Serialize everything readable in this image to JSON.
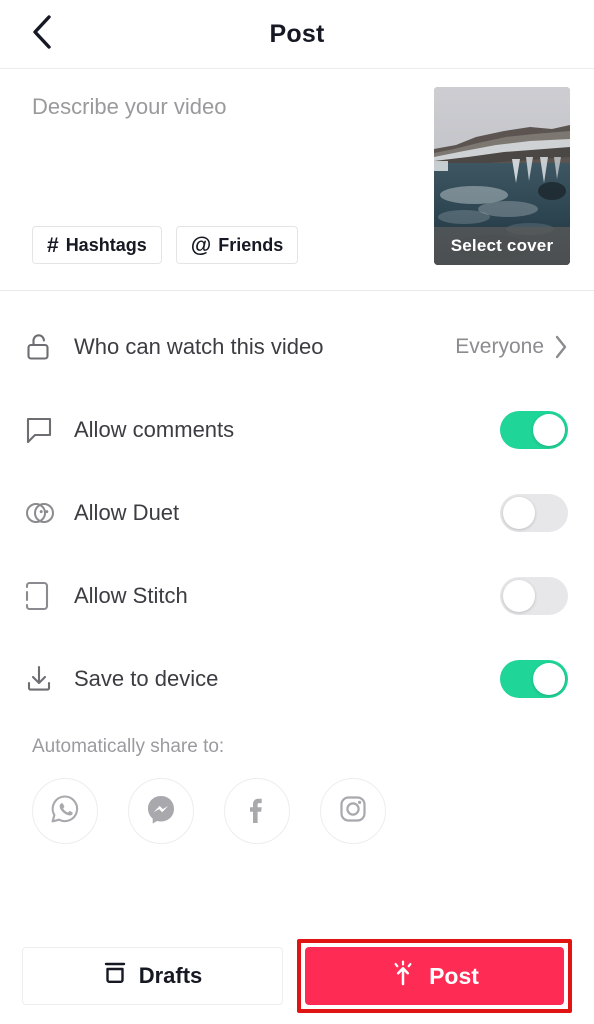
{
  "header": {
    "title": "Post",
    "back_icon": "chevron-left-icon"
  },
  "caption": {
    "placeholder": "Describe your video",
    "value": "",
    "chips": [
      {
        "glyph": "#",
        "label": "Hashtags",
        "icon": "hashtag-icon"
      },
      {
        "glyph": "@",
        "label": "Friends",
        "icon": "at-mention-icon"
      }
    ]
  },
  "cover": {
    "label": "Select cover",
    "image_description": "winter river landscape with snowy rocks",
    "colors": {
      "sky": "#c9c9ce",
      "ridge": "#4a4440",
      "snow": "#e8eaec",
      "water": "#36505a",
      "water_dark": "#22333c"
    }
  },
  "settings": [
    {
      "icon": "unlock-icon",
      "label": "Who can watch this video",
      "control": "value",
      "value": "Everyone",
      "chevron": "chevron-right-icon"
    },
    {
      "icon": "comment-bubble-icon",
      "label": "Allow comments",
      "control": "toggle",
      "state": "on"
    },
    {
      "icon": "duet-icon",
      "label": "Allow Duet",
      "control": "toggle",
      "state": "off"
    },
    {
      "icon": "stitch-icon",
      "label": "Allow Stitch",
      "control": "toggle",
      "state": "off"
    },
    {
      "icon": "download-icon",
      "label": "Save to device",
      "control": "toggle",
      "state": "on"
    }
  ],
  "share": {
    "title": "Automatically share to:",
    "targets": [
      {
        "name": "whatsapp",
        "icon": "whatsapp-icon"
      },
      {
        "name": "messenger",
        "icon": "messenger-icon"
      },
      {
        "name": "facebook",
        "icon": "facebook-icon"
      },
      {
        "name": "instagram",
        "icon": "instagram-icon"
      }
    ]
  },
  "bottom_bar": {
    "drafts_label": "Drafts",
    "drafts_icon": "archive-box-icon",
    "post_label": "Post",
    "post_icon": "upload-burst-icon"
  },
  "colors": {
    "brand_pink": "#fe2c55",
    "toggle_on": "#1fd598",
    "toggle_off": "#e7e7e9",
    "annotation": "#e11414",
    "text_primary": "#161823",
    "text_secondary": "#3c3c42",
    "text_muted": "#9a9a9d"
  }
}
